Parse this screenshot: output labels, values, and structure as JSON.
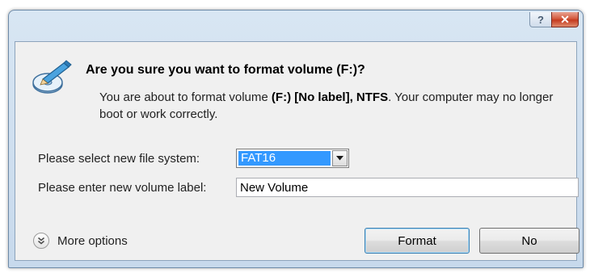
{
  "titlebar": {
    "help_glyph": "?",
    "close_glyph": "✕"
  },
  "header": {
    "icon": "format-disk-icon",
    "question": "Are you sure you want to format volume (F:)?",
    "desc_pre": "You are about to format volume ",
    "volume_id": "(F:) [No label], NTFS",
    "desc_post": ". Your computer may no longer boot or work correctly."
  },
  "form": {
    "file_system_label": "Please select new file system:",
    "file_system_value": "FAT16",
    "volume_label_label": "Please enter new volume label:",
    "volume_label_value": "New Volume"
  },
  "footer": {
    "more_options_label": "More options",
    "format_label": "Format",
    "no_label": "No"
  },
  "colors": {
    "selection": "#3399ff",
    "close_button": "#c43b1f",
    "frame": "#c7d9ec"
  }
}
